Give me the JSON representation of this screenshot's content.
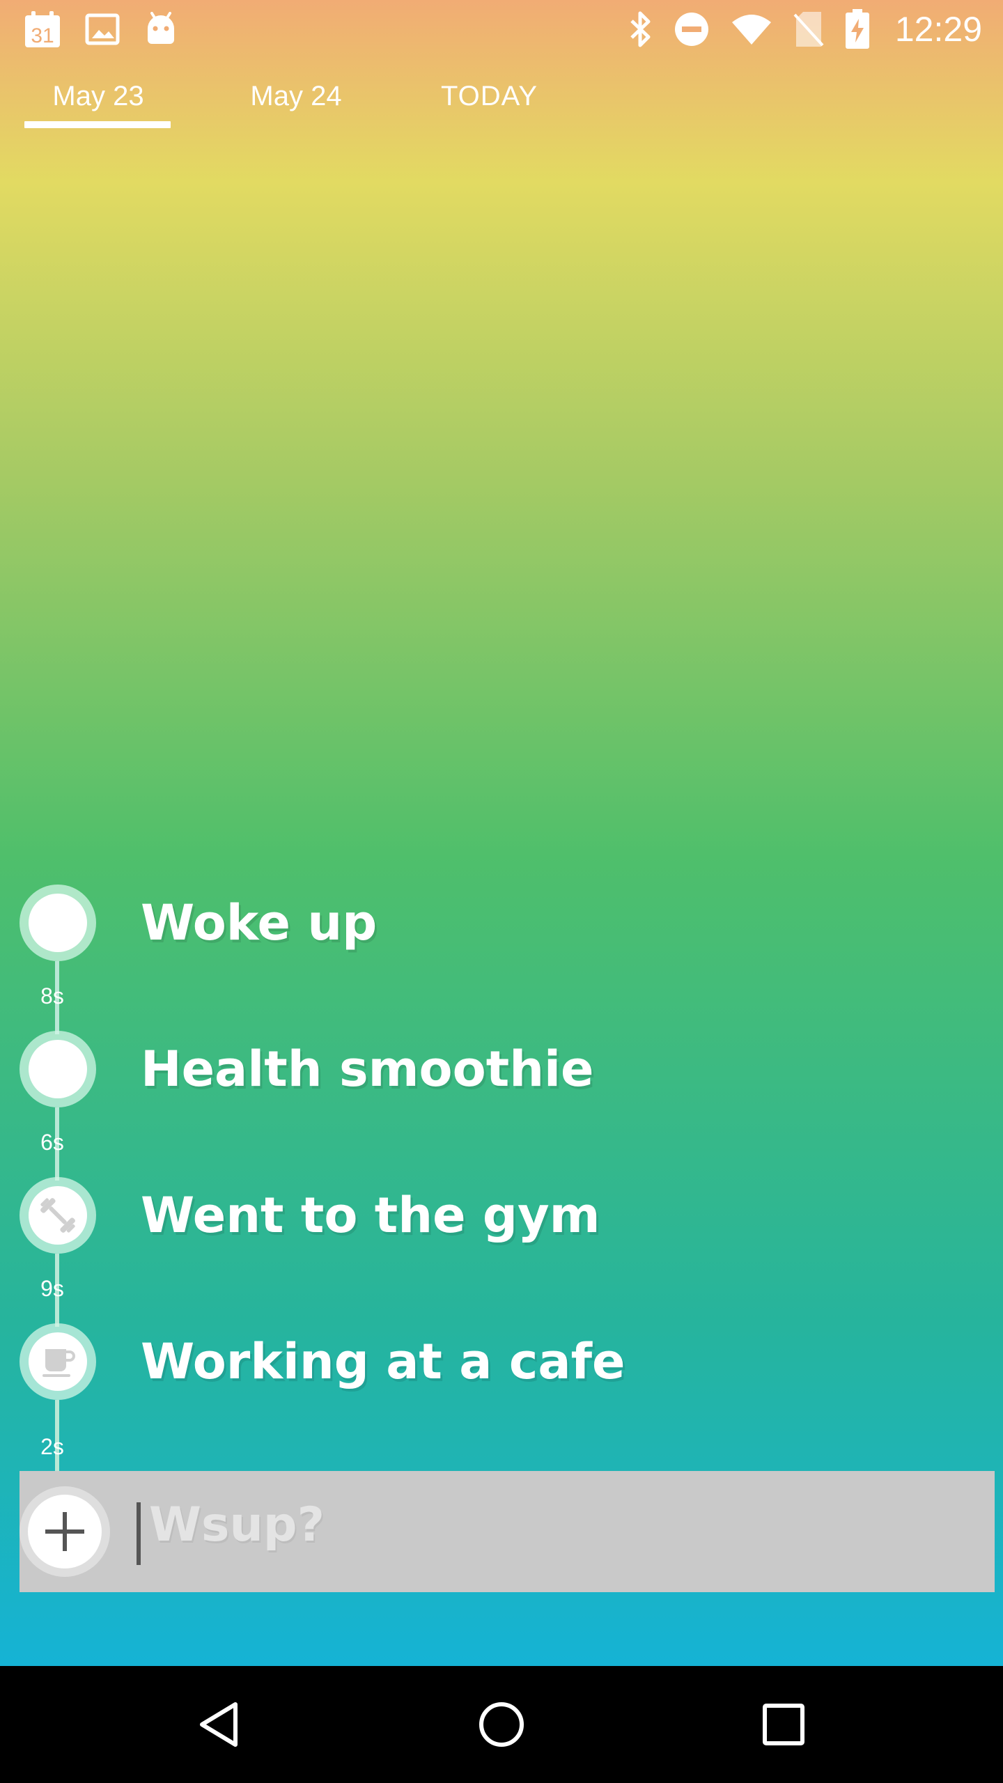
{
  "status_bar": {
    "time": "12:29",
    "calendar_day": "31",
    "left_icons": [
      "calendar-icon",
      "image-icon",
      "android-icon"
    ],
    "right_icons": [
      "bluetooth-icon",
      "do-not-disturb-icon",
      "wifi-icon",
      "no-sim-icon",
      "battery-charging-icon"
    ]
  },
  "tabs": [
    {
      "label": "May 23",
      "selected": true
    },
    {
      "label": "May 24",
      "selected": false
    },
    {
      "label": "TODAY",
      "selected": false
    }
  ],
  "timeline": {
    "entries": [
      {
        "label": "Woke up",
        "icon": "empty-circle-icon"
      },
      {
        "label": "Health smoothie",
        "icon": "empty-circle-icon"
      },
      {
        "label": "Went to the gym",
        "icon": "dumbbell-icon"
      },
      {
        "label": "Working at a cafe",
        "icon": "coffee-cup-icon"
      }
    ],
    "durations": [
      "8s",
      "6s",
      "9s",
      "2s"
    ]
  },
  "input": {
    "placeholder": "Wsup?",
    "value": "",
    "add_icon": "plus-icon"
  },
  "nav": {
    "icons": [
      "back-icon",
      "home-icon",
      "recents-icon"
    ]
  },
  "colors": {
    "gradient_top": "#f1ac74",
    "gradient_yellow": "#e2da62",
    "gradient_green": "#4fbf6b",
    "gradient_bottom": "#15b3d5",
    "input_bar": "#c9c9c9"
  }
}
